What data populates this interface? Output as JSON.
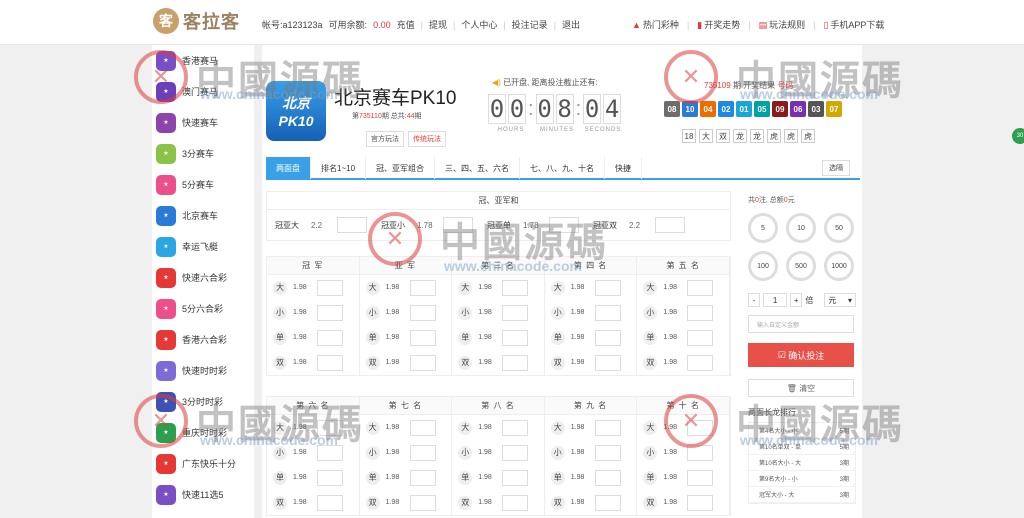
{
  "header": {
    "logo_icon": "客",
    "logo_text": "客拉客",
    "account_label": "帐号:a123123a",
    "balance_label": "可用余额:",
    "balance_value": "0.00",
    "links": [
      "充值",
      "提现",
      "个人中心",
      "投注记录",
      "退出"
    ],
    "right_links": [
      "热门彩种",
      "开奖走势",
      "玩法规则",
      "手机APP下载"
    ]
  },
  "sidebar": {
    "items": [
      {
        "label": "香港赛马",
        "color": "#7b4fc4"
      },
      {
        "label": "澳门赛马",
        "color": "#6a3fb8"
      },
      {
        "label": "快速赛车",
        "color": "#8e44ad"
      },
      {
        "label": "3分赛车",
        "color": "#8bc34a"
      },
      {
        "label": "5分赛车",
        "color": "#ec4f8a"
      },
      {
        "label": "北京赛车",
        "color": "#2a7bd5"
      },
      {
        "label": "幸运飞艇",
        "color": "#2aa7e0"
      },
      {
        "label": "快速六合彩",
        "color": "#e53935"
      },
      {
        "label": "5分六合彩",
        "color": "#ec4f8a"
      },
      {
        "label": "香港六合彩",
        "color": "#e53935"
      },
      {
        "label": "快速时时彩",
        "color": "#7e6bd8"
      },
      {
        "label": "3分时时彩",
        "color": "#3f51b5"
      },
      {
        "label": "重庆时时彩",
        "color": "#2e9e4f"
      },
      {
        "label": "广东快乐十分",
        "color": "#e53935"
      },
      {
        "label": "快速11选5",
        "color": "#7b4fc4"
      }
    ]
  },
  "game": {
    "logo_top": "北京",
    "logo_bottom": "PK10",
    "title": "北京赛车PK10",
    "period_prefix": "第",
    "period_num": "735110",
    "period_mid": "期 总共:",
    "period_total": "44",
    "period_suffix": "期",
    "play_official": "官方玩法",
    "play_traditional": "传统玩法"
  },
  "timer": {
    "title": "已开盘, 距离投注截止还有:",
    "digits": [
      "0",
      "0",
      "0",
      "8",
      "0",
      "4"
    ],
    "labels": [
      "HOURS",
      "MINUTES",
      "SECONDS"
    ]
  },
  "results": {
    "period_num": "735109",
    "period_text": "期 开奖结果",
    "link": "号码",
    "balls": [
      {
        "n": "08",
        "color": "#6d6d6d"
      },
      {
        "n": "10",
        "color": "#2a7bd5"
      },
      {
        "n": "04",
        "color": "#ef6c00"
      },
      {
        "n": "02",
        "color": "#1e88e5"
      },
      {
        "n": "01",
        "color": "#1aa5d8"
      },
      {
        "n": "05",
        "color": "#00a3a3"
      },
      {
        "n": "09",
        "color": "#8b1a1a"
      },
      {
        "n": "06",
        "color": "#7b2fb0"
      },
      {
        "n": "03",
        "color": "#555555"
      },
      {
        "n": "07",
        "color": "#d4a800"
      }
    ],
    "sums": [
      "18",
      "大",
      "双",
      "龙",
      "龙",
      "虎",
      "虎",
      "虎"
    ]
  },
  "tabs": [
    "两面盘",
    "排名1~10",
    "冠、亚军组合",
    "三、四、五、六名",
    "七、八、九、十名",
    "快捷"
  ],
  "tab_right": "选隔",
  "sum_section": {
    "title": "冠、亚军和",
    "items": [
      {
        "label": "冠亚大",
        "odds": "2.2"
      },
      {
        "label": "冠亚小",
        "odds": "1.78"
      },
      {
        "label": "冠亚单",
        "odds": "1.78"
      },
      {
        "label": "冠亚双",
        "odds": "2.2"
      }
    ]
  },
  "grid1": {
    "headers": [
      "冠 军",
      "亚 军",
      "第 三 名",
      "第 四 名",
      "第 五 名"
    ],
    "rows": [
      {
        "k": "大",
        "odds": "1.98"
      },
      {
        "k": "小",
        "odds": "1.98"
      },
      {
        "k": "单",
        "odds": "1.98"
      },
      {
        "k": "双",
        "odds": "1.98"
      }
    ]
  },
  "grid2": {
    "headers": [
      "第 六 名",
      "第 七 名",
      "第 八 名",
      "第 九 名",
      "第 十 名"
    ],
    "rows": [
      {
        "k": "大",
        "odds": "1.98"
      },
      {
        "k": "小",
        "odds": "1.98"
      },
      {
        "k": "单",
        "odds": "1.98"
      },
      {
        "k": "双",
        "odds": "1.98"
      }
    ]
  },
  "bet_panel": {
    "total_prefix": "共",
    "total_count": "0",
    "total_mid": "注, 总额",
    "total_amount": "0",
    "total_suffix": "元",
    "chips": [
      "5",
      "10",
      "50",
      "100",
      "500",
      "1000"
    ],
    "minus": "-",
    "qty": "1",
    "plus": "+",
    "times": "倍",
    "unit": "元",
    "custom_placeholder": "输入自定义金额",
    "confirm": "确认投注",
    "clear": "清空",
    "streak_title": "两面长龙排行",
    "streak": [
      {
        "a": "第4名大小 - 小",
        "b": "5期"
      },
      {
        "a": "第10名单双 - 单",
        "b": "5期"
      },
      {
        "a": "第10名大小 - 大",
        "b": "3期"
      },
      {
        "a": "第9名大小 - 小",
        "b": "3期"
      },
      {
        "a": "冠军大小 - 大",
        "b": "3期"
      }
    ]
  },
  "refresh_label": "30",
  "watermark": {
    "text": "中國源碼",
    "sub": "www.chinacode.com"
  }
}
